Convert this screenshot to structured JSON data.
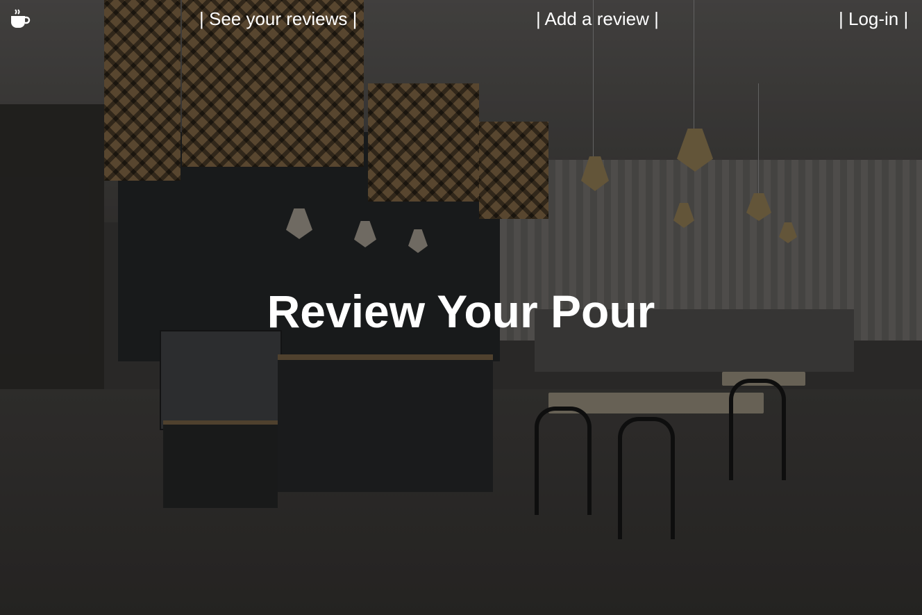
{
  "nav": {
    "logo_icon": "coffee-cup-icon",
    "links": [
      {
        "label": "| See your reviews |"
      },
      {
        "label": "| Add a review |"
      },
      {
        "label": "| Log-in |"
      }
    ]
  },
  "hero": {
    "title": "Review Your Pour",
    "background": "cafe-interior-photo"
  },
  "colors": {
    "text": "#ffffff",
    "overlay": "rgba(0,0,0,0.28)"
  }
}
